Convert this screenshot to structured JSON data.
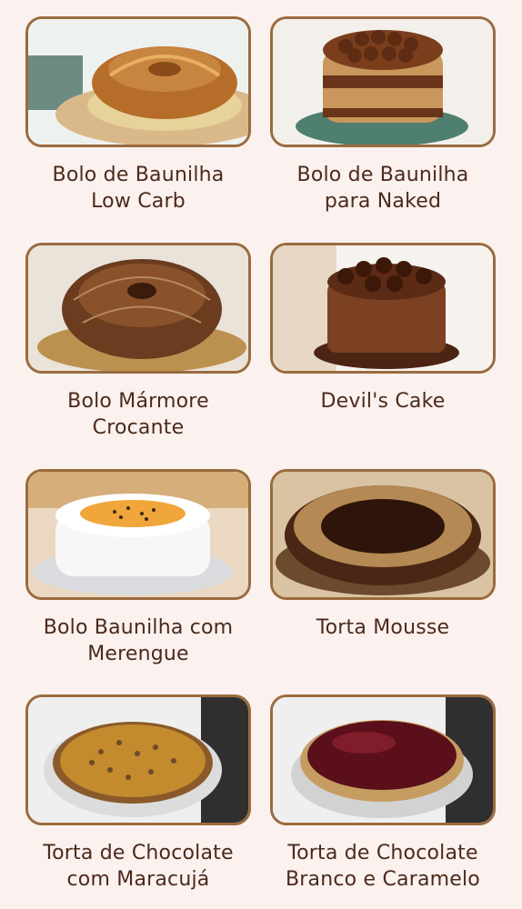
{
  "products": [
    {
      "line1": "Bolo de Baunilha",
      "line2": "Low Carb"
    },
    {
      "line1": "Bolo de Baunilha",
      "line2": "para Naked"
    },
    {
      "line1": "Bolo Mármore",
      "line2": "Crocante"
    },
    {
      "line1": "Devil's Cake",
      "line2": ""
    },
    {
      "line1": "Bolo Baunilha com",
      "line2": "Merengue"
    },
    {
      "line1": "Torta Mousse",
      "line2": ""
    },
    {
      "line1": "Torta de Chocolate",
      "line2": "com Maracujá"
    },
    {
      "line1": "Torta de Chocolate",
      "line2": "Branco e Caramelo"
    }
  ]
}
